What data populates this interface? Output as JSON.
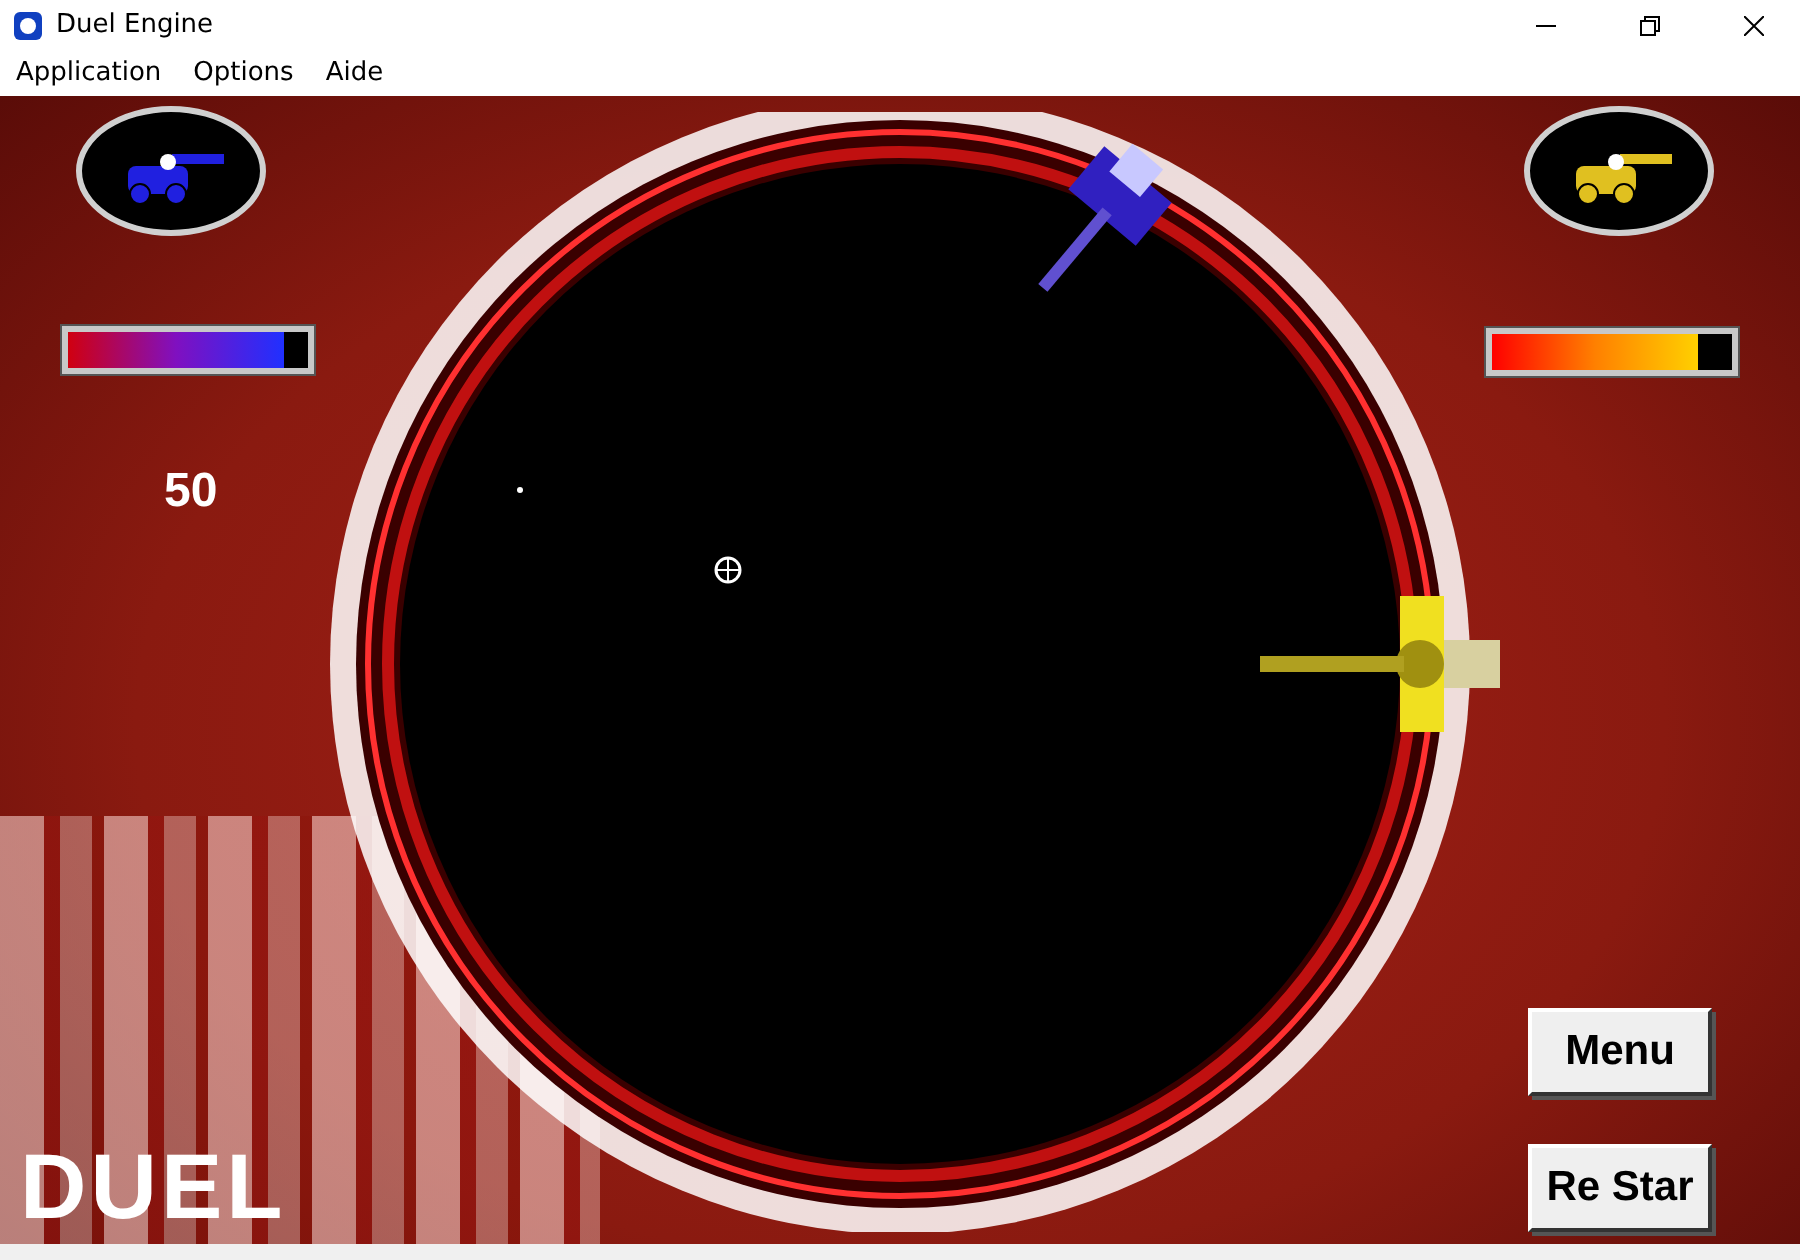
{
  "window": {
    "title": "Duel Engine"
  },
  "menu": [
    "Application",
    "Options",
    "Aide"
  ],
  "players": [
    {
      "level": 0.9,
      "score": "50"
    },
    {
      "level": 0.86
    }
  ],
  "logo": "DUEL",
  "buttons": [
    {
      "label": "Menu"
    },
    {
      "label": "Re Star"
    }
  ]
}
